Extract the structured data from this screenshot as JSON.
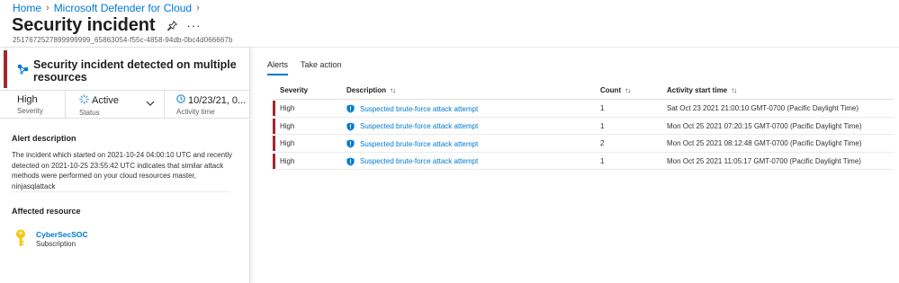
{
  "breadcrumb": {
    "items": [
      "Home",
      "Microsoft Defender for Cloud"
    ],
    "separator": ">"
  },
  "page": {
    "title": "Security incident",
    "subtitle": "2517672527899999999_65863054-f55c-4858-94db-0bc4d066667b"
  },
  "incident": {
    "title": "Security incident detected on multiple resources",
    "severity_value": "High",
    "severity_label": "Severity",
    "status_value": "Active",
    "status_label": "Status",
    "activity_value": "10/23/21, 0...",
    "activity_label": "Activity time"
  },
  "alert_description": {
    "heading": "Alert description",
    "text": "The incident which started on 2021-10-24 04:00:10 UTC and recently detected on 2021-10-25 23:55:42 UTC indicates that similar attack methods were performed on your cloud resources master, ninjasqlattack"
  },
  "affected_resource": {
    "heading": "Affected resource",
    "name": "CyberSecSOC",
    "type": "Subscription"
  },
  "tabs": [
    {
      "label": "Alerts",
      "active": true
    },
    {
      "label": "Take action",
      "active": false
    }
  ],
  "grid": {
    "columns": {
      "severity": "Severity",
      "description": "Description",
      "count": "Count",
      "start": "Activity start time"
    },
    "rows": [
      {
        "severity": "High",
        "description": "Suspected brute-force attack attempt",
        "count": "1",
        "start": "Sat Oct 23 2021 21:00:10 GMT-0700 (Pacific Daylight Time)"
      },
      {
        "severity": "High",
        "description": "Suspected brute-force attack attempt",
        "count": "1",
        "start": "Mon Oct 25 2021 07:20:15 GMT-0700 (Pacific Daylight Time)"
      },
      {
        "severity": "High",
        "description": "Suspected brute-force attack attempt",
        "count": "2",
        "start": "Mon Oct 25 2021 08:12:48 GMT-0700 (Pacific Daylight Time)"
      },
      {
        "severity": "High",
        "description": "Suspected brute-force attack attempt",
        "count": "1",
        "start": "Mon Oct 25 2021 11:05:17 GMT-0700 (Pacific Daylight Time)"
      }
    ]
  },
  "colors": {
    "accent": "#0078d4",
    "severity_high": "#a4262c",
    "key_icon": "#f2c811"
  },
  "icons": {
    "pin": "pin-icon",
    "more": "more-icon",
    "incident": "incident-icon",
    "status": "status-active-icon",
    "clock": "clock-icon",
    "chevron": "chevron-down-icon",
    "key": "key-icon",
    "shield": "shield-icon",
    "sort": "sort-icon"
  }
}
